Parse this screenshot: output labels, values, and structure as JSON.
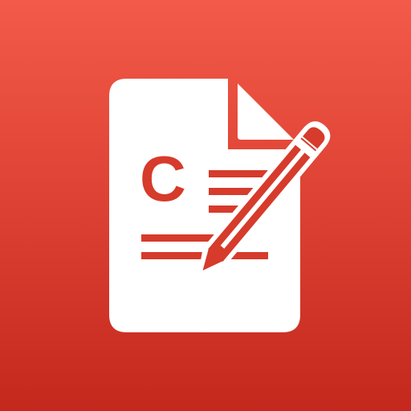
{
  "icon": {
    "name": "document-edit-app-icon",
    "glyph": "document-with-pencil-icon",
    "doc_letter": "C",
    "colors": {
      "background_top": "#f45a49",
      "background_bottom": "#c4281d",
      "document": "#ffffff",
      "ink": "#d63b2b"
    }
  }
}
